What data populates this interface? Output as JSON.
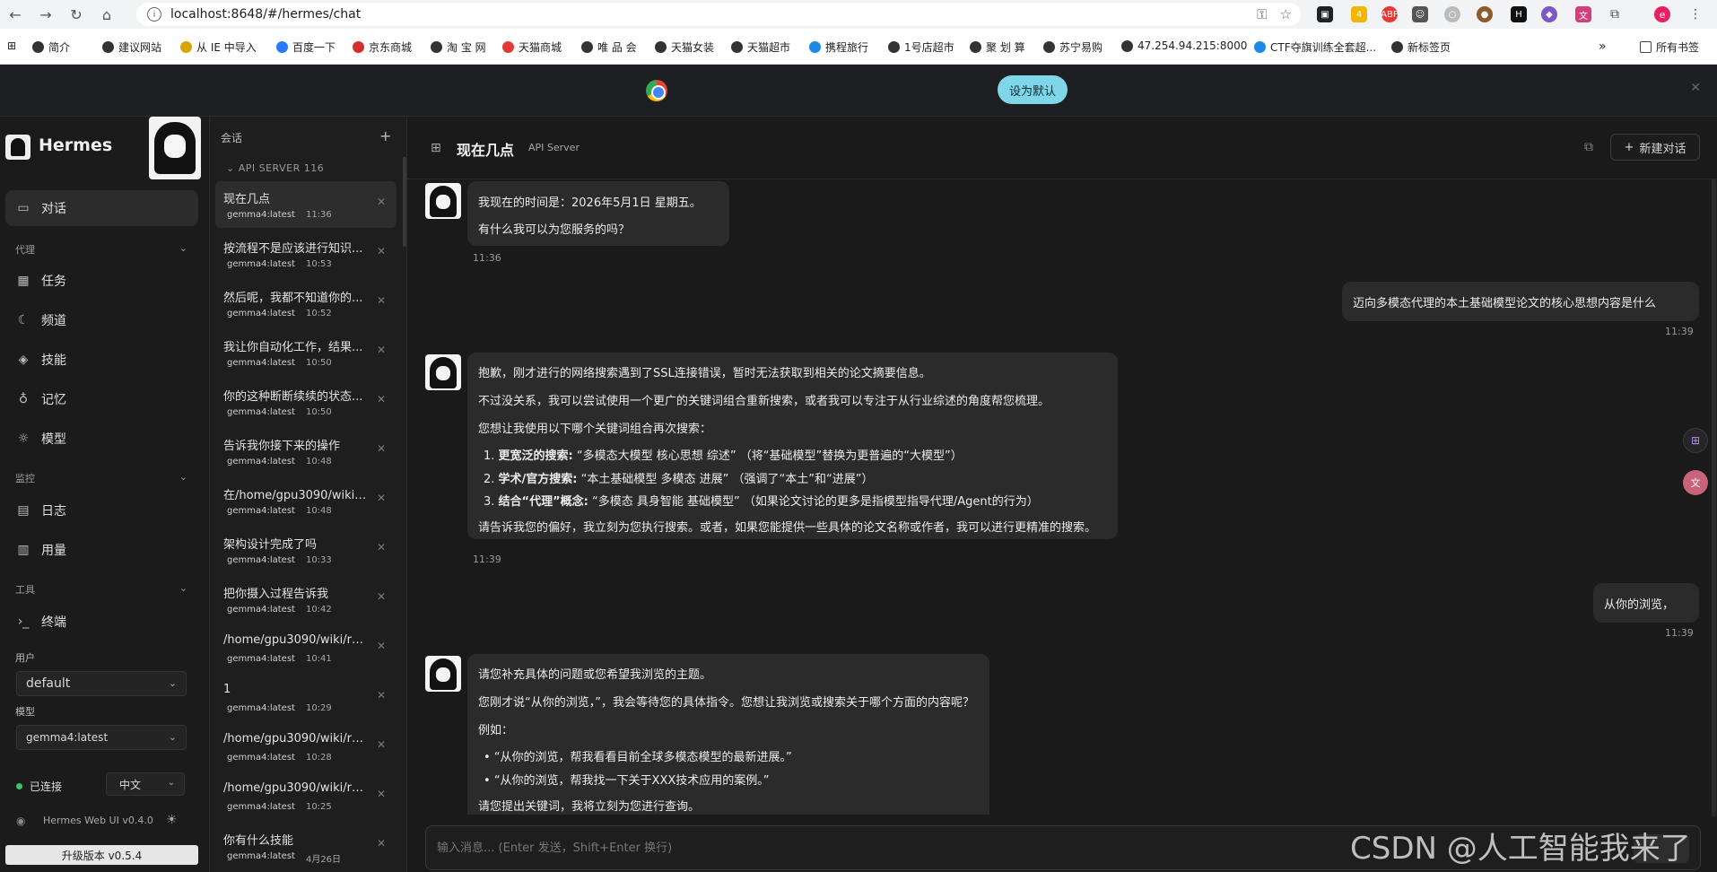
{
  "browser": {
    "url": "localhost:8648/#/hermes/chat",
    "bookmarks": [
      "简介",
      "建议网站",
      "从 IE 中导入",
      "百度一下",
      "京东商城",
      "淘 宝 网",
      "天猫商城",
      "唯 品 会",
      "天猫女装",
      "天猫超市",
      "携程旅行",
      "1号店超市",
      "聚 划 算",
      "苏宁易购",
      "47.254.94.215:8000",
      "CTF夺旗训练全套超...",
      "新标签页"
    ],
    "bookmarks_more": "»",
    "all_bookmarks": "所有书签",
    "profile_initial": "e",
    "ext_badge": "4"
  },
  "banner": {
    "message": "",
    "button_label": "设为默认"
  },
  "sidebar": {
    "app_name": "Hermes",
    "nav_main": [
      {
        "label": "对话",
        "icon": "chat-icon"
      }
    ],
    "section_agent": "代理",
    "nav_agent": [
      {
        "label": "任务",
        "icon": "calendar-icon"
      },
      {
        "label": "频道",
        "icon": "moon-icon"
      },
      {
        "label": "技能",
        "icon": "layers-icon"
      },
      {
        "label": "记忆",
        "icon": "bulb-icon"
      },
      {
        "label": "模型",
        "icon": "sun-icon"
      }
    ],
    "section_monitor": "监控",
    "nav_monitor": [
      {
        "label": "日志",
        "icon": "file-icon"
      },
      {
        "label": "用量",
        "icon": "bar-chart-icon"
      }
    ],
    "section_tools": "工具",
    "nav_tools": [
      {
        "label": "终端",
        "icon": "terminal-icon"
      }
    ],
    "user_label": "用户",
    "user_value": "default",
    "model_label": "模型",
    "model_value": "gemma4:latest",
    "status": "已连接",
    "language": "中文",
    "version_text": "Hermes Web UI v0.4.0",
    "upgrade_label": "升级版本 v0.5.4"
  },
  "sessions": {
    "title": "会话",
    "group": "API SERVER",
    "group_count": "116",
    "items": [
      {
        "title": "现在几点",
        "model": "gemma4:latest",
        "time": "11:36"
      },
      {
        "title": "按流程不是应该进行知识...",
        "model": "gemma4:latest",
        "time": "10:53"
      },
      {
        "title": "然后呢，我都不知道你的...",
        "model": "gemma4:latest",
        "time": "10:52"
      },
      {
        "title": "我让你自动化工作，结果...",
        "model": "gemma4:latest",
        "time": "10:50"
      },
      {
        "title": "你的这种断断续续的状态...",
        "model": "gemma4:latest",
        "time": "10:50"
      },
      {
        "title": "告诉我你接下来的操作",
        "model": "gemma4:latest",
        "time": "10:48"
      },
      {
        "title": "在/home/gpu3090/wiki/tes...",
        "model": "gemma4:latest",
        "time": "10:48"
      },
      {
        "title": "架构设计完成了吗",
        "model": "gemma4:latest",
        "time": "10:33"
      },
      {
        "title": "把你摄入过程告诉我",
        "model": "gemma4:latest",
        "time": "10:42"
      },
      {
        "title": "/home/gpu3090/wiki/raw/a...",
        "model": "gemma4:latest",
        "time": "10:41"
      },
      {
        "title": "1",
        "model": "gemma4:latest",
        "time": "10:29"
      },
      {
        "title": "/home/gpu3090/wiki/raw/a...",
        "model": "gemma4:latest",
        "time": "10:28"
      },
      {
        "title": "/home/gpu3090/wiki/raw/a...",
        "model": "gemma4:latest",
        "time": "10:25"
      },
      {
        "title": "你有什么技能",
        "model": "gemma4:latest",
        "time": "4月26日"
      }
    ]
  },
  "chat": {
    "title": "现在几点",
    "subtitle": "API Server",
    "new_chat_label": "新建对话",
    "messages": {
      "a1": {
        "lines": [
          "我现在的时间是：2026年5月1日 星期五。",
          "有什么我可以为您服务的吗？"
        ],
        "time": "11:36"
      },
      "u1": {
        "text": "迈向多模态代理的本土基础模型论文的核心思想内容是什么",
        "time": "11:39"
      },
      "a2": {
        "line1": "抱歉，刚才进行的网络搜索遇到了SSL连接错误，暂时无法获取到相关的论文摘要信息。",
        "line2": "不过没关系，我可以尝试使用一个更广的关键词组合重新搜索，或者我可以专注于从行业综述的角度帮您梳理。",
        "line3": "您想让我使用以下哪个关键词组合再次搜索：",
        "items": [
          {
            "bold": "更宽泛的搜索:",
            "text": " “多模态大模型 核心思想 综述” （将“基础模型”替换为更普遍的“大模型”）"
          },
          {
            "bold": "学术/官方搜索:",
            "text": " “本土基础模型 多模态 进展” （强调了“本土”和“进展”）"
          },
          {
            "bold": "结合“代理”概念:",
            "text": " “多模态 具身智能 基础模型” （如果论文讨论的更多是指模型指导代理/Agent的行为）"
          }
        ],
        "line4": "请告诉我您的偏好，我立刻为您执行搜索。或者，如果您能提供一些具体的论文名称或作者，我可以进行更精准的搜索。",
        "time": "11:39"
      },
      "u2": {
        "text": "从你的浏览，",
        "time": "11:39"
      },
      "a3": {
        "line1": "请您补充具体的问题或您希望我浏览的主题。",
        "line2": "您刚才说“从你的浏览，”，我会等待您的具体指令。您想让我浏览或搜索关于哪个方面的内容呢？",
        "line3": "例如：",
        "bullets": [
          "“从你的浏览，帮我看看目前全球多模态模型的最新进展。”",
          "“从你的浏览，帮我找一下关于XXX技术应用的案例。”"
        ],
        "line4": "请您提出关键词，我将立刻为您进行查询。"
      }
    },
    "composer_placeholder": "输入消息... (Enter 发送，Shift+Enter 换行)"
  },
  "watermark": "CSDN @人工智能我来了"
}
